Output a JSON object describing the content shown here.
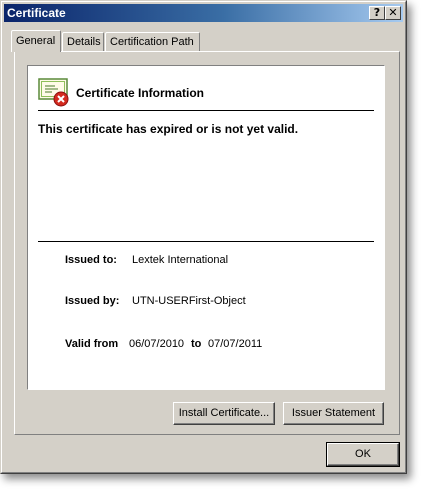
{
  "window": {
    "title": "Certificate",
    "help_button": "?",
    "close_button": "✕"
  },
  "tabs": [
    {
      "label": "General",
      "active": true
    },
    {
      "label": "Details",
      "active": false
    },
    {
      "label": "Certification Path",
      "active": false
    }
  ],
  "certificate": {
    "heading": "Certificate Information",
    "status": "This certificate has expired or is not yet valid.",
    "issued_to_label": "Issued to:",
    "issued_to_value": "Lextek International",
    "issued_by_label": "Issued by:",
    "issued_by_value": "UTN-USERFirst-Object",
    "valid_from_label": "Valid from",
    "valid_from_value": "06/07/2010",
    "to_label": "to",
    "valid_to_value": "07/07/2011",
    "icon": "certificate-error-icon"
  },
  "buttons": {
    "install": "Install Certificate...",
    "issuer_statement": "Issuer Statement",
    "ok": "OK"
  },
  "colors": {
    "titlebar_start": "#0a246a",
    "titlebar_end": "#a6caf0",
    "dialog_face": "#d4d0c8",
    "error_red": "#d42a1e"
  }
}
